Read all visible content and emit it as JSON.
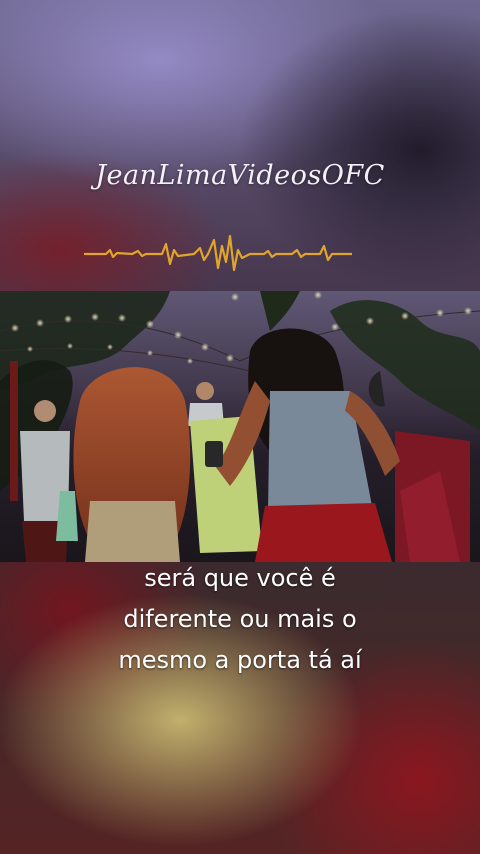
{
  "watermark": {
    "text": "JeanLimaVideosOFC"
  },
  "icons": {
    "audio_waveform": "audio-waveform-icon"
  },
  "colors": {
    "waveform": "#e0a52a",
    "subtitle": "#ffffff",
    "watermark": "#f4f0f8"
  },
  "subtitle": {
    "line1": "será que você é",
    "line2": "diferente ou mais o",
    "line3": "mesmo a porta tá aí"
  }
}
